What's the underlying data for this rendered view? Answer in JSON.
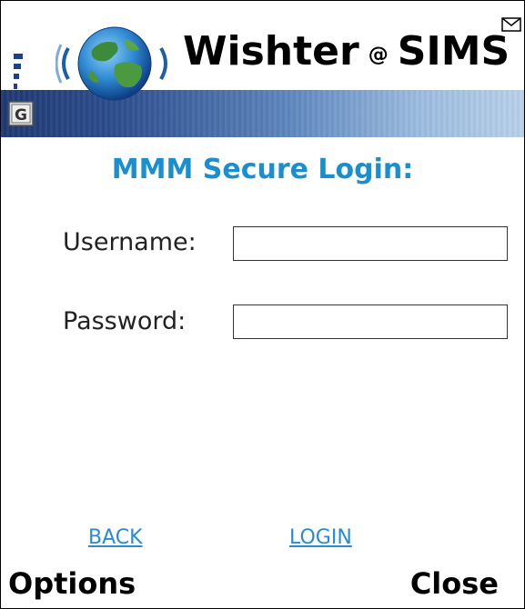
{
  "header": {
    "app_name": "Wishter",
    "at_symbol": "@",
    "brand_suffix": "SIMS",
    "icons": {
      "signal": "signal-strength-icon",
      "globe": "globe-logo-icon",
      "mail": "mail-icon",
      "gprs": "g-connection-icon"
    },
    "gprs_letter": "G",
    "colors": {
      "band_dark": "#1f3a73",
      "band_light": "#b9d0ea"
    }
  },
  "login": {
    "title": "MMM Secure Login:",
    "title_color": "#1a8fcd",
    "username_label": "Username:",
    "username_value": "",
    "password_label": "Password:",
    "password_value": ""
  },
  "links": {
    "back": "BACK",
    "login": "LOGIN",
    "color": "#2a8ad2"
  },
  "softkeys": {
    "left": "Options",
    "right": "Close"
  }
}
